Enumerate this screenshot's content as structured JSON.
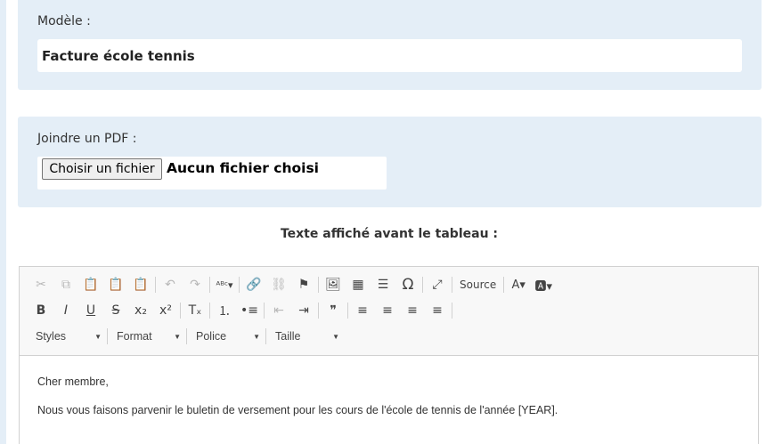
{
  "model": {
    "label": "Modèle :",
    "value": "Facture école tennis"
  },
  "pdf": {
    "label": "Joindre un PDF :",
    "button_label": "Choisir un fichier",
    "status": "Aucun fichier choisi"
  },
  "editor": {
    "heading": "Texte affiché avant le tableau :",
    "toolbar": {
      "row1": [
        {
          "name": "cut-icon",
          "glyph": "✂",
          "disabled": true
        },
        {
          "name": "copy-icon",
          "glyph": "⧉",
          "disabled": true
        },
        {
          "name": "paste-icon",
          "glyph": "📋",
          "disabled": false
        },
        {
          "name": "paste-text-icon",
          "glyph": "📋",
          "disabled": false
        },
        {
          "name": "paste-word-icon",
          "glyph": "📋",
          "disabled": false
        },
        {
          "sep": true
        },
        {
          "name": "undo-icon",
          "glyph": "↶",
          "disabled": true
        },
        {
          "name": "redo-icon",
          "glyph": "↷",
          "disabled": true
        },
        {
          "sep": true
        },
        {
          "name": "spellcheck-icon",
          "glyph": "ᴬᴮᶜ▾",
          "disabled": false
        },
        {
          "sep": true
        },
        {
          "name": "link-icon",
          "glyph": "🔗",
          "disabled": false
        },
        {
          "name": "unlink-icon",
          "glyph": "⛓",
          "disabled": true
        },
        {
          "name": "anchor-flag-icon",
          "glyph": "⚑",
          "disabled": false
        },
        {
          "sep": true
        },
        {
          "name": "image-icon",
          "glyph": "🖼",
          "disabled": false
        },
        {
          "name": "table-icon",
          "glyph": "▦",
          "disabled": false
        },
        {
          "name": "horizontal-line-icon",
          "glyph": "☰",
          "disabled": false
        },
        {
          "name": "special-char-icon",
          "glyph": "Ω",
          "disabled": false
        },
        {
          "sep": true
        },
        {
          "name": "maximize-icon",
          "glyph": "⤢",
          "disabled": false
        },
        {
          "sep": true
        },
        {
          "name": "source-button",
          "glyph": "Source",
          "disabled": false,
          "wide": true
        },
        {
          "sep": true
        },
        {
          "name": "text-color-icon",
          "glyph": "A▾",
          "disabled": false
        },
        {
          "name": "background-color-icon",
          "glyph": "🅰▾",
          "disabled": false
        }
      ],
      "row2": [
        {
          "name": "bold-icon",
          "glyph": "B",
          "disabled": false
        },
        {
          "name": "italic-icon",
          "glyph": "I",
          "disabled": false
        },
        {
          "name": "underline-icon",
          "glyph": "U",
          "disabled": false
        },
        {
          "name": "strike-icon",
          "glyph": "S",
          "disabled": false
        },
        {
          "name": "subscript-icon",
          "glyph": "x₂",
          "disabled": false
        },
        {
          "name": "superscript-icon",
          "glyph": "x²",
          "disabled": false
        },
        {
          "sep": true
        },
        {
          "name": "remove-format-icon",
          "glyph": "Tₓ",
          "disabled": false
        },
        {
          "sep": true
        },
        {
          "name": "numbered-list-icon",
          "glyph": "⒈",
          "disabled": false
        },
        {
          "name": "bulleted-list-icon",
          "glyph": "•≡",
          "disabled": false
        },
        {
          "sep": true
        },
        {
          "name": "outdent-icon",
          "glyph": "⇤",
          "disabled": true
        },
        {
          "name": "indent-icon",
          "glyph": "⇥",
          "disabled": false
        },
        {
          "sep": true
        },
        {
          "name": "blockquote-icon",
          "glyph": "❞",
          "disabled": false
        },
        {
          "sep": true
        },
        {
          "name": "align-left-icon",
          "glyph": "≡",
          "disabled": false
        },
        {
          "name": "align-center-icon",
          "glyph": "≡",
          "disabled": false
        },
        {
          "name": "align-right-icon",
          "glyph": "≡",
          "disabled": false
        },
        {
          "name": "justify-icon",
          "glyph": "≡",
          "disabled": false
        },
        {
          "sep": true
        }
      ],
      "combos": [
        {
          "name": "styles-combo",
          "label": "Styles"
        },
        {
          "name": "format-combo",
          "label": "Format"
        },
        {
          "name": "font-combo",
          "label": "Police"
        },
        {
          "name": "size-combo",
          "label": "Taille"
        }
      ]
    },
    "content": [
      "Cher membre,",
      "Nous vous faisons parvenir le buletin de versement pour les cours de l'école de tennis de l'année [YEAR]."
    ]
  }
}
